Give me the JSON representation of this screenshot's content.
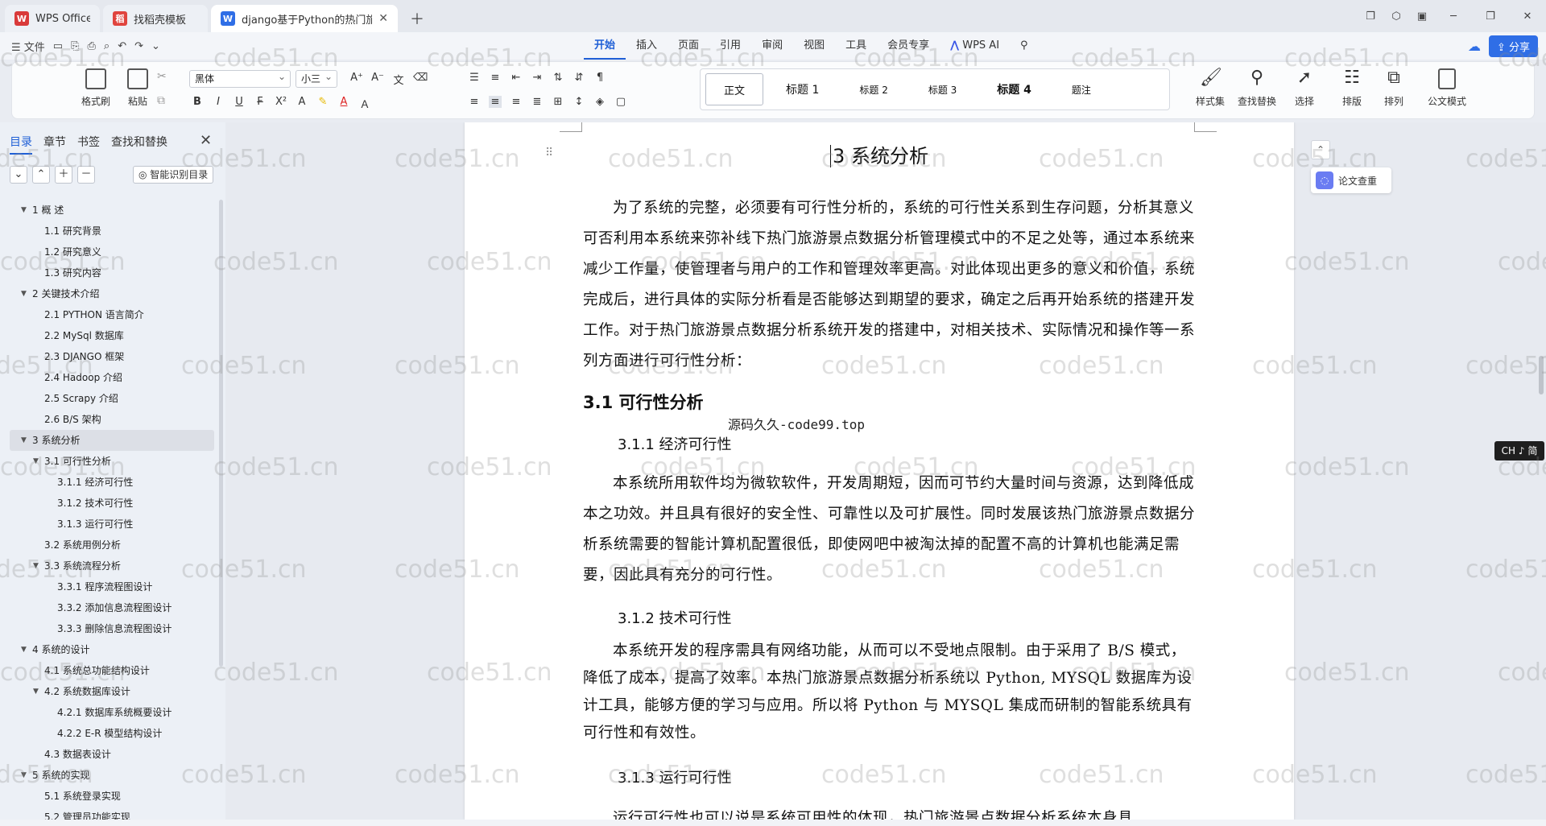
{
  "tabs": [
    {
      "label": "WPS Office",
      "icon": "W"
    },
    {
      "label": "找稻壳模板",
      "icon": "稻"
    },
    {
      "label": "django基于Python的热门旅",
      "icon": "W"
    }
  ],
  "menu": {
    "file": "☰ 文件",
    "tabs": [
      "开始",
      "插入",
      "页面",
      "引用",
      "审阅",
      "视图",
      "工具",
      "会员专享"
    ],
    "wps_ai": "WPS AI",
    "share": "分享"
  },
  "ribbon": {
    "format_brush": "格式刷",
    "paste": "粘贴",
    "font_name": "黑体",
    "font_size": "小三",
    "styles": [
      "正文",
      "标题 1",
      "标题 2",
      "标题 3",
      "标题 4",
      "题注"
    ],
    "style_set": "样式集",
    "find_replace": "查找替换",
    "select": "选择",
    "layout": "排版",
    "arrange": "排列",
    "official_mode": "公文模式"
  },
  "sidebar": {
    "tabs": [
      "目录",
      "章节",
      "书签",
      "查找和替换"
    ],
    "smart_toc": "智能识别目录",
    "toc": [
      {
        "label": "1    概    述",
        "level": 1,
        "expanded": true
      },
      {
        "label": "1.1 研究背景",
        "level": 2
      },
      {
        "label": "1.2 研究意义",
        "level": 2
      },
      {
        "label": "1.3 研究内容",
        "level": 2
      },
      {
        "label": "2    关键技术介绍",
        "level": 1,
        "expanded": true
      },
      {
        "label": "2.1 PYTHON 语言简介",
        "level": 2
      },
      {
        "label": "2.2 MySql 数据库",
        "level": 2
      },
      {
        "label": "2.3 DJANGO 框架",
        "level": 2
      },
      {
        "label": "2.4 Hadoop 介绍",
        "level": 2
      },
      {
        "label": "2.5 Scrapy 介绍",
        "level": 2
      },
      {
        "label": "2.6 B/S 架构",
        "level": 2
      },
      {
        "label": "3    系统分析",
        "level": 1,
        "expanded": true,
        "active": true
      },
      {
        "label": "3.1    可行性分析",
        "level": 2,
        "expanded": true
      },
      {
        "label": "3.1.1 经济可行性",
        "level": 3
      },
      {
        "label": "3.1.2 技术可行性",
        "level": 3
      },
      {
        "label": "3.1.3 运行可行性",
        "level": 3
      },
      {
        "label": "3.2 系统用例分析",
        "level": 2
      },
      {
        "label": "3.3 系统流程分析",
        "level": 2,
        "expanded": true
      },
      {
        "label": "3.3.1 程序流程图设计",
        "level": 3
      },
      {
        "label": "3.3.2 添加信息流程图设计",
        "level": 3
      },
      {
        "label": "3.3.3 删除信息流程图设计",
        "level": 3
      },
      {
        "label": "4    系统的设计",
        "level": 1,
        "expanded": true
      },
      {
        "label": "4.1  系统总功能结构设计",
        "level": 2
      },
      {
        "label": "4.2  系统数据库设计",
        "level": 2,
        "expanded": true
      },
      {
        "label": "4.2.1  数据库系统概要设计",
        "level": 3
      },
      {
        "label": "4.2.2 E-R 模型结构设计",
        "level": 3
      },
      {
        "label": "4.3 数据表设计",
        "level": 2
      },
      {
        "label": "5    系统的实现",
        "level": 1,
        "expanded": true
      },
      {
        "label": "5.1 系统登录实现",
        "level": 2
      },
      {
        "label": "5.2 管理员功能实现",
        "level": 2
      }
    ]
  },
  "document": {
    "chapter_title": "3  系统分析",
    "para1": "为了系统的完整，必须要有可行性分析的，系统的可行性关系到生存问题，分析其意义可否利用本系统来弥补线下热门旅游景点数据分析管理模式中的不足之处等，通过本系统来减少工作量，使管理者与用户的工作和管理效率更高。对此体现出更多的意义和价值，系统完成后，进行具体的实际分析看是否能够达到期望的要求，确定之后再开始系统的搭建开发工作。对于热门旅游景点数据分析系统开发的搭建中，对相关技术、实际情况和操作等一系列方面进行可行性分析：",
    "h_3_1": "3.1    可行性分析",
    "source_note": "源码久久-code99.top",
    "h_3_1_1": "3.1.1 经济可行性",
    "para2": "本系统所用软件均为微软软件，开发周期短，因而可节约大量时间与资源，达到降低成本之功效。并且具有很好的安全性、可靠性以及可扩展性。同时发展该热门旅游景点数据分析系统需要的智能计算机配置很低，即使网吧中被淘汰掉的配置不高的计算机也能满足需要，因此具有充分的可行性。",
    "h_3_1_2": "3.1.2 技术可行性",
    "para3": "本系统开发的程序需具有网络功能，从而可以不受地点限制。由于采用了 B/S 模式，降低了成本，提高了效率。本热门旅游景点数据分析系统以 Python, MYSQL 数据库为设计工具，能够方便的学习与应用。所以将 Python 与 MYSQL 集成而研制的智能系统具有可行性和有效性。",
    "h_3_1_3": "3.1.3 运行可行性",
    "para4": "运行可行性也可以说是系统可用性的体现，热门旅游景点数据分析系统本身具"
  },
  "side": {
    "paper_check": "论文查重",
    "ime": "CH ♪ 简"
  },
  "watermark": "code51.cn",
  "colors": {
    "accent": "#1f5fd6",
    "wps_red": "#d93a3a",
    "doc_blue": "#2f6ee6"
  }
}
